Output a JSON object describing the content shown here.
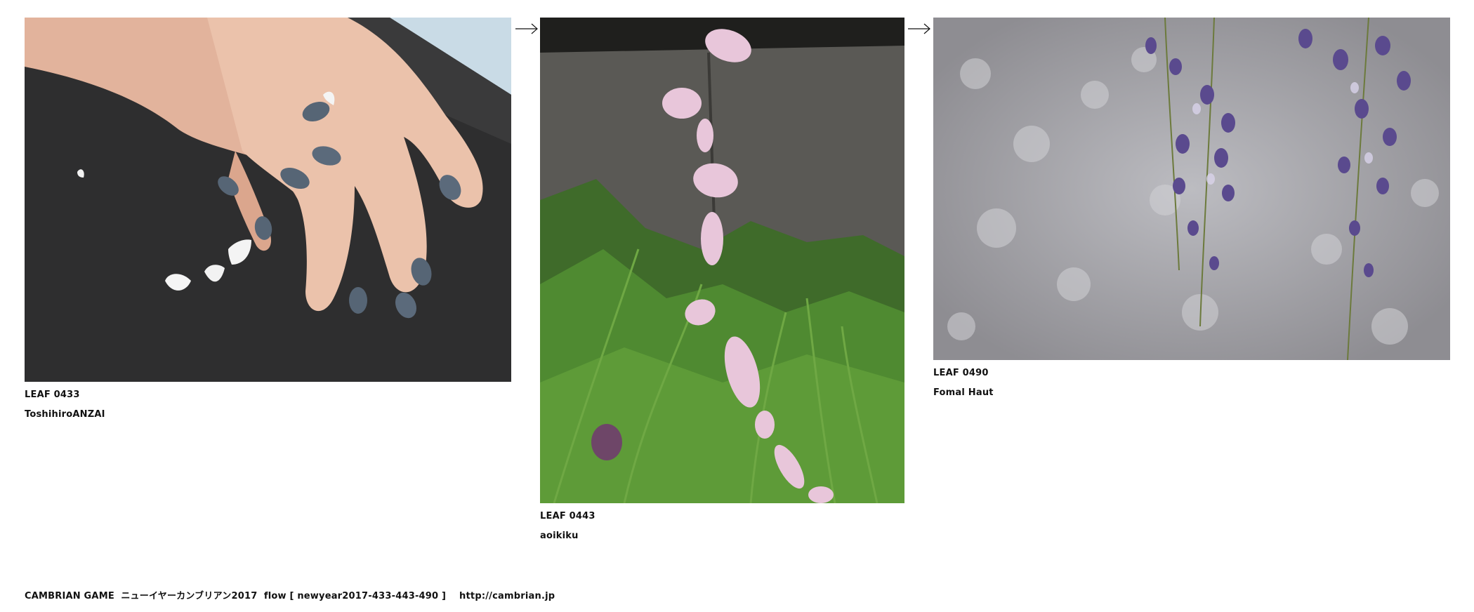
{
  "leaves": [
    {
      "id_label": "LEAF 0433",
      "author": "ToshihiroANZAI",
      "image_subject": "hands with dark grey nail polish on black paper with white petals"
    },
    {
      "id_label": "LEAF 0443",
      "author": "aoikiku",
      "image_subject": "pink petals falling over stone wall and green weeds"
    },
    {
      "id_label": "LEAF 0490",
      "author": "Fomal Haut",
      "image_subject": "purple wisteria hanging against blurred background"
    }
  ],
  "arrows": {
    "icon": "right-arrow-icon"
  },
  "footer": {
    "text": "CAMBRIAN GAME  ニューイヤーカンブリアン2017  flow [ newyear2017-433-443-490 ]    http://cambrian.jp"
  },
  "colors": {
    "background": "#ffffff",
    "text": "#111111"
  }
}
